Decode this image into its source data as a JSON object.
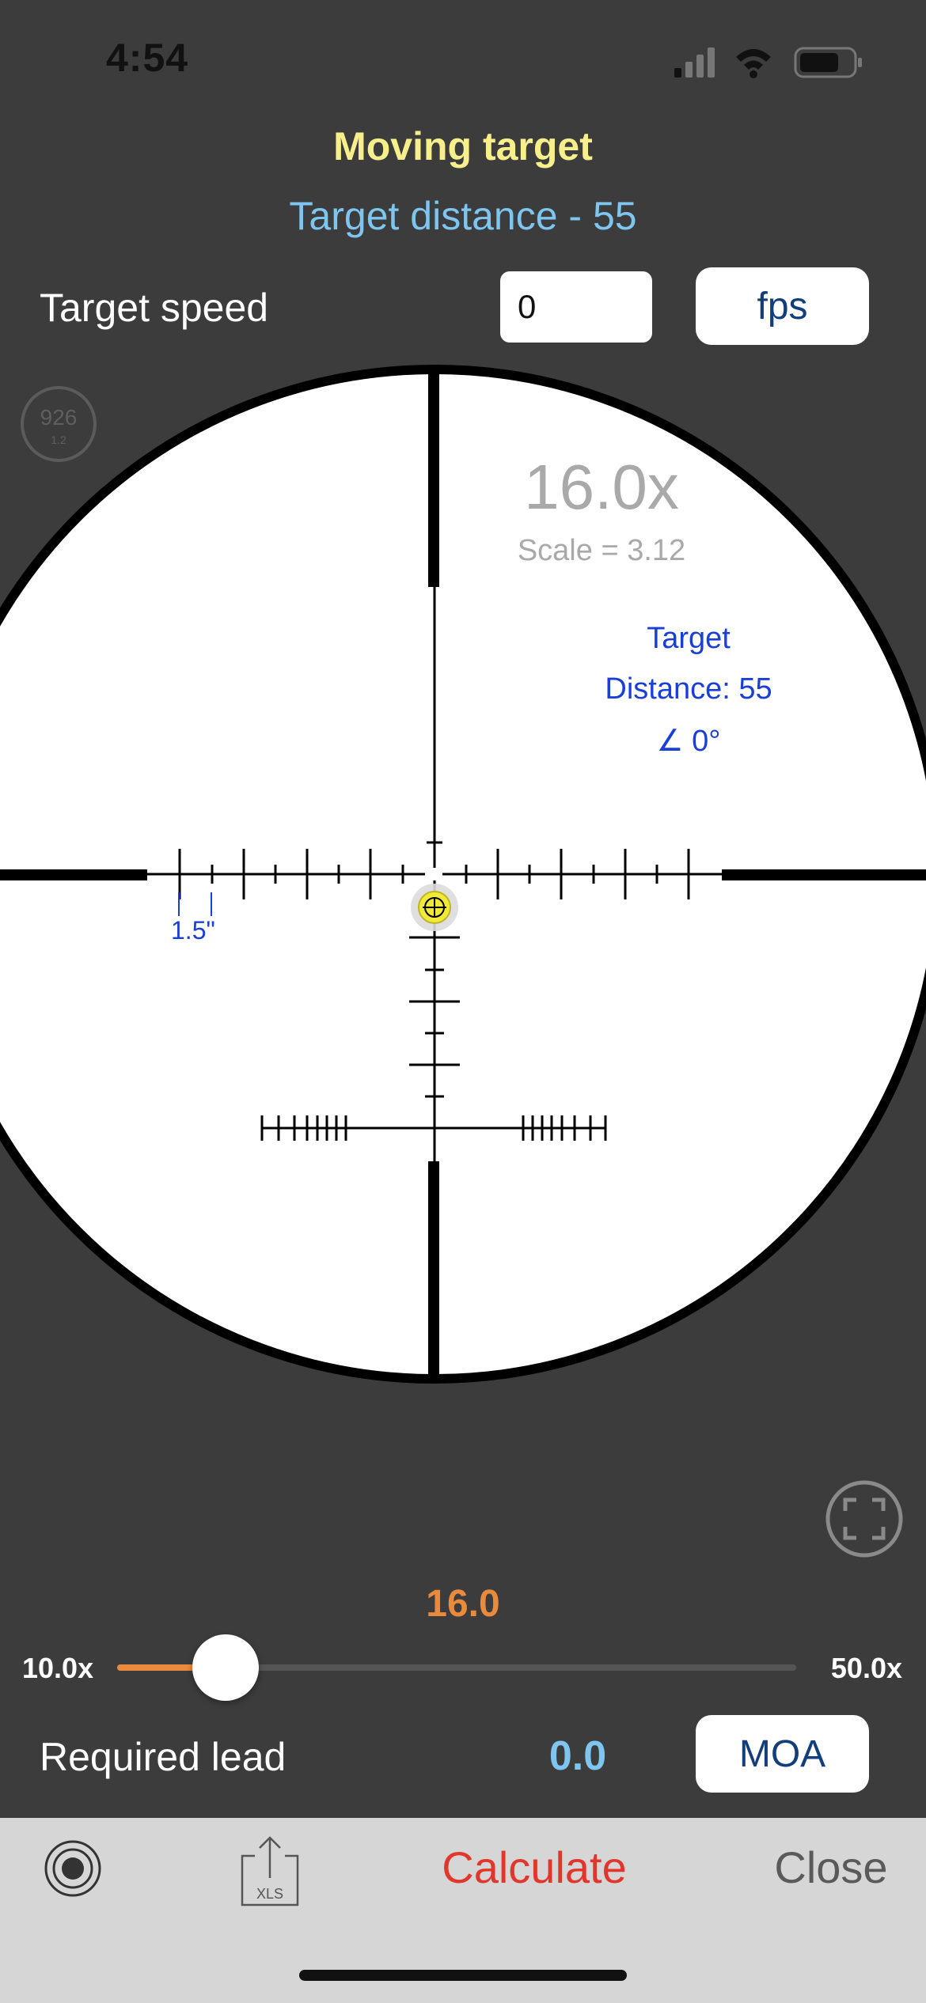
{
  "status_bar": {
    "time": "4:54"
  },
  "header": {
    "title": "Moving target",
    "subtitle": "Target distance - 55"
  },
  "speed": {
    "label": "Target speed",
    "value": "0",
    "unit_button": "fps"
  },
  "badge": {
    "number": "926",
    "sub": "1.2"
  },
  "scope": {
    "magnification": "16.0x",
    "scale": "Scale = 3.12",
    "target_label": "Target",
    "distance": "Distance: 55",
    "angle": "∠ 0°",
    "tick_label": "1.5\""
  },
  "zoom": {
    "value": "16.0",
    "min_label": "10.0x",
    "max_label": "50.0x",
    "min": 10.0,
    "max": 50.0,
    "current": 16.0,
    "fill_color": "#ea8a3c"
  },
  "lead": {
    "label": "Required lead",
    "value": "0.0",
    "unit_button": "MOA"
  },
  "toolbar": {
    "target_icon": "target-icon",
    "export_icon": "xls-export-icon",
    "export_icon_text": "XLS",
    "calculate": "Calculate",
    "close": "Close"
  },
  "colors": {
    "background": "#3c3c3c",
    "title": "#f7ef8c",
    "accent_blue": "#7ec6f0",
    "orange": "#ea8a3c",
    "calculate": "#e0362c"
  }
}
